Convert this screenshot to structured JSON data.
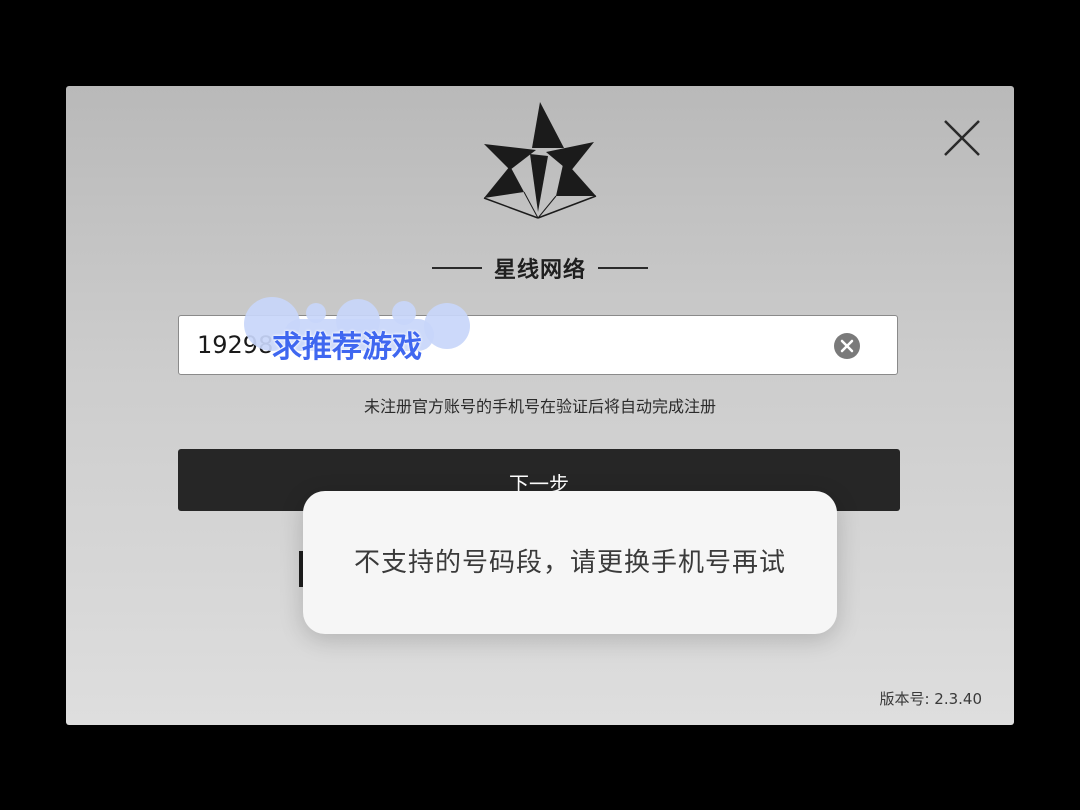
{
  "brand": {
    "name": "星线网络",
    "logo_icon": "star-logo-icon"
  },
  "login": {
    "phone_value": "19298",
    "hint": "未注册官方账号的手机号在验证后将自动完成注册",
    "next_label": "下一步",
    "clear_icon": "clear-circle-icon",
    "close_icon": "close-icon"
  },
  "version": {
    "label": "版本号: 2.3.40"
  },
  "toast": {
    "message": "不支持的号码段，请更换手机号再试"
  },
  "overlay": {
    "text": "求推荐游戏"
  },
  "colors": {
    "button_bg": "#262626",
    "overlay_text": "#3f67f0",
    "toast_bg": "#f6f6f6"
  }
}
